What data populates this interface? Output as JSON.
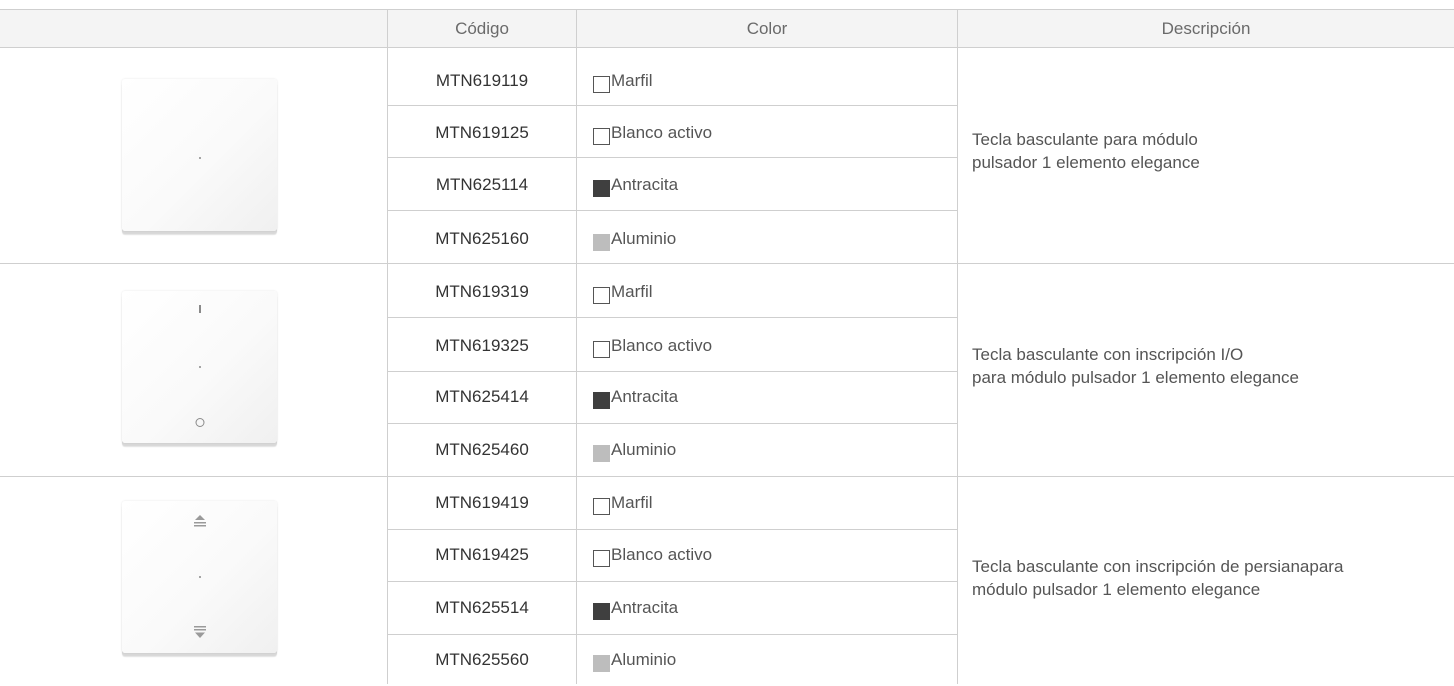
{
  "table": {
    "headers": {
      "code": "Código",
      "color": "Color",
      "description": "Descripción"
    },
    "groups": [
      {
        "description_lines": [
          "Tecla basculante para módulo",
          "pulsador 1 elemento elegance"
        ],
        "device_marks": "dot",
        "rows": [
          {
            "code": "MTN619119",
            "color": "Marfil",
            "swatch": "marfil"
          },
          {
            "code": "MTN619125",
            "color": "Blanco activo",
            "swatch": "blanco"
          },
          {
            "code": "MTN625114",
            "color": "Antracita",
            "swatch": "antracita"
          },
          {
            "code": "MTN625160",
            "color": "Aluminio",
            "swatch": "aluminio"
          }
        ]
      },
      {
        "description_lines": [
          "Tecla basculante con inscripción I/O",
          "para módulo pulsador 1 elemento elegance"
        ],
        "device_marks": "I-dot-O",
        "rows": [
          {
            "code": "MTN619319",
            "color": "Marfil",
            "swatch": "marfil"
          },
          {
            "code": "MTN619325",
            "color": "Blanco activo",
            "swatch": "blanco"
          },
          {
            "code": "MTN625414",
            "color": "Antracita",
            "swatch": "antracita"
          },
          {
            "code": "MTN625460",
            "color": "Aluminio",
            "swatch": "aluminio"
          }
        ]
      },
      {
        "description_lines": [
          "Tecla basculante con inscripción de persianapara",
          "módulo pulsador 1 elemento elegance"
        ],
        "device_marks": "up-dot-down",
        "rows": [
          {
            "code": "MTN619419",
            "color": "Marfil",
            "swatch": "marfil"
          },
          {
            "code": "MTN619425",
            "color": "Blanco activo",
            "swatch": "blanco"
          },
          {
            "code": "MTN625514",
            "color": "Antracita",
            "swatch": "antracita"
          },
          {
            "code": "MTN625560",
            "color": "Aluminio",
            "swatch": "aluminio"
          }
        ]
      }
    ],
    "swatch_colors": {
      "marfil": "#ffffff",
      "blanco": "#ffffff",
      "antracita": "#3f3f3f",
      "aluminio": "#bdbdbd"
    }
  }
}
